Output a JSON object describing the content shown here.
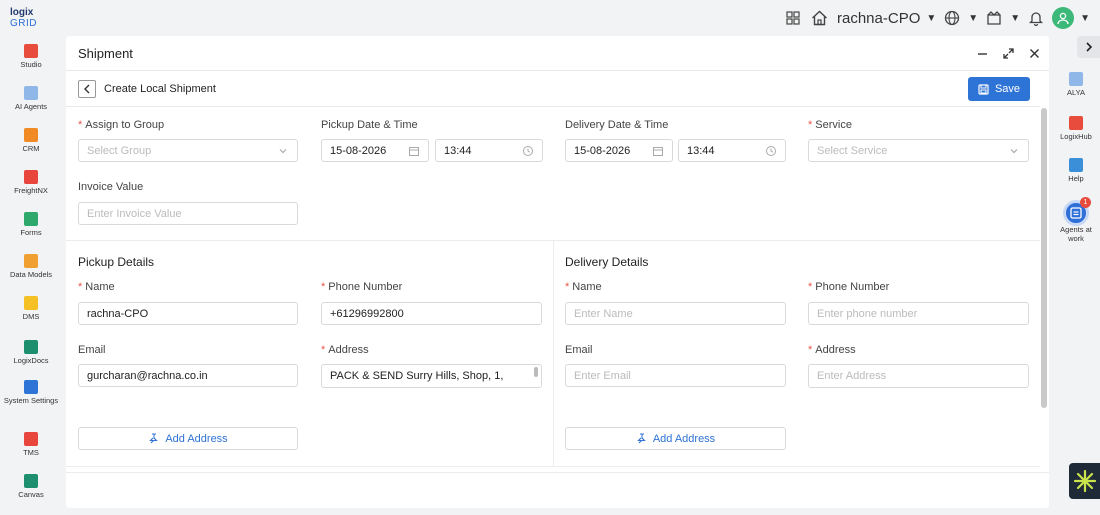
{
  "logo": {
    "line1": "logix",
    "line2": "GRID"
  },
  "topbar": {
    "org_name": "rachna-CPO"
  },
  "sidebar": {
    "items": [
      {
        "label": "Studio",
        "color": "#e84c3d"
      },
      {
        "label": "AI Agents",
        "color": "#8fb7e8"
      },
      {
        "label": "CRM",
        "color": "#f08a24"
      },
      {
        "label": "FreightNX",
        "color": "#e8453c"
      },
      {
        "label": "Forms",
        "color": "#2ea86b"
      },
      {
        "label": "Data Models",
        "color": "#f0a030"
      },
      {
        "label": "DMS",
        "color": "#f5c023"
      },
      {
        "label": "LogixDocs",
        "color": "#1e8f6e"
      },
      {
        "label": "System Settings",
        "color": "#2e73d6"
      },
      {
        "label": "TMS",
        "color": "#e8453c"
      },
      {
        "label": "Canvas",
        "color": "#1e8f6e"
      }
    ]
  },
  "right_sidebar": {
    "items": [
      {
        "label": "ALYA",
        "color": "#8fb7e8"
      },
      {
        "label": "LogixHub",
        "color": "#e84c3d"
      },
      {
        "label": "Help",
        "color": "#3a8fd8"
      }
    ],
    "agents": {
      "label": "Agents at work",
      "count": "1"
    }
  },
  "panel": {
    "title": "Shipment",
    "sub_title": "Create Local Shipment",
    "save_label": "Save"
  },
  "form": {
    "assign_group": {
      "label": "Assign to Group",
      "placeholder": "Select Group"
    },
    "pickup_dt": {
      "label": "Pickup Date & Time",
      "date": "15-08-2026",
      "time": "13:44"
    },
    "delivery_dt": {
      "label": "Delivery Date & Time",
      "date": "15-08-2026",
      "time": "13:44"
    },
    "service": {
      "label": "Service",
      "placeholder": "Select Service"
    },
    "invoice": {
      "label": "Invoice Value",
      "placeholder": "Enter Invoice Value"
    }
  },
  "pickup": {
    "title": "Pickup Details",
    "name_label": "Name",
    "name_value": "rachna-CPO",
    "phone_label": "Phone Number",
    "phone_value": "+61296992800",
    "email_label": "Email",
    "email_value": "gurcharan@rachna.co.in",
    "address_label": "Address",
    "address_value": "PACK & SEND Surry Hills, Shop, 1,",
    "add_address": "Add Address"
  },
  "delivery": {
    "title": "Delivery Details",
    "name_label": "Name",
    "name_placeholder": "Enter Name",
    "phone_label": "Phone Number",
    "phone_placeholder": "Enter phone number",
    "email_label": "Email",
    "email_placeholder": "Enter Email",
    "address_label": "Address",
    "address_placeholder": "Enter Address",
    "add_address": "Add Address"
  }
}
